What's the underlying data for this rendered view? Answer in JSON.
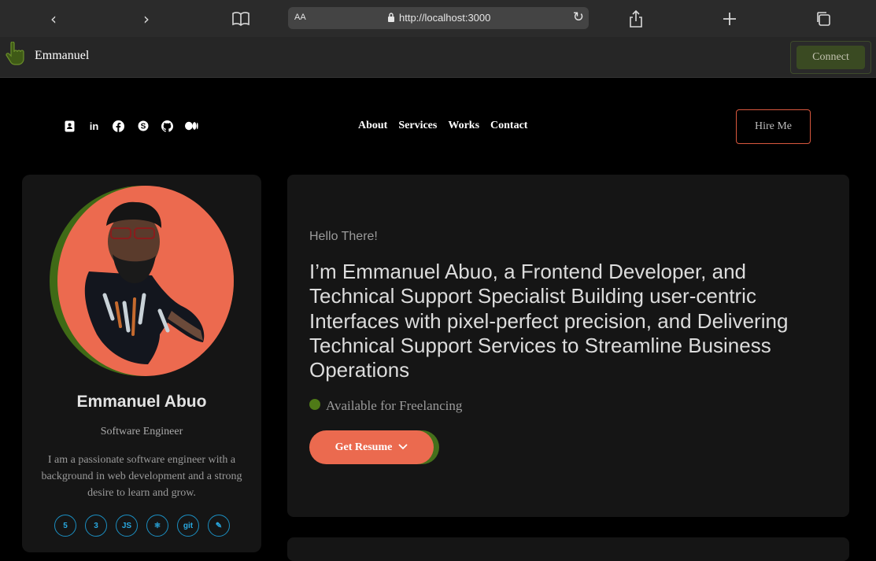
{
  "browser": {
    "address_prefix": "AA",
    "url": "http://localhost:3000"
  },
  "extension": {
    "name": "Emmanuel",
    "connect_label": "Connect"
  },
  "header": {
    "social_icons": [
      "contact-card-icon",
      "linkedin-icon",
      "facebook-icon",
      "skype-icon",
      "github-icon",
      "medium-icon"
    ],
    "menu": [
      "About",
      "Services",
      "Works",
      "Contact"
    ],
    "hire_label": "Hire Me"
  },
  "profile": {
    "name": "Emmanuel Abuo",
    "role": "Software Engineer",
    "bio": "I am a passionate software engineer with a background in web development and a strong desire to learn and grow.",
    "tech": [
      {
        "icon": "html5-icon",
        "glyph": "5"
      },
      {
        "icon": "css3-icon",
        "glyph": "3"
      },
      {
        "icon": "javascript-icon",
        "glyph": "JS"
      },
      {
        "icon": "react-icon",
        "glyph": "⚛"
      },
      {
        "icon": "git-icon",
        "glyph": "git"
      },
      {
        "icon": "evernote-icon",
        "glyph": "✎"
      }
    ]
  },
  "hero": {
    "greeting": "Hello There!",
    "headline": "I’m Emmanuel Abuo, a Frontend Developer, and Technical Support Specialist Building user-centric Interfaces with pixel-perfect precision, and Delivering Technical Support Services to Streamline Business Operations",
    "availability": "Available for Freelancing",
    "resume_label": "Get Resume"
  },
  "colors": {
    "accent": "#eb6a4f",
    "accent_green": "#4f7a17",
    "card": "#151515",
    "tech": "#1b8fc2"
  }
}
